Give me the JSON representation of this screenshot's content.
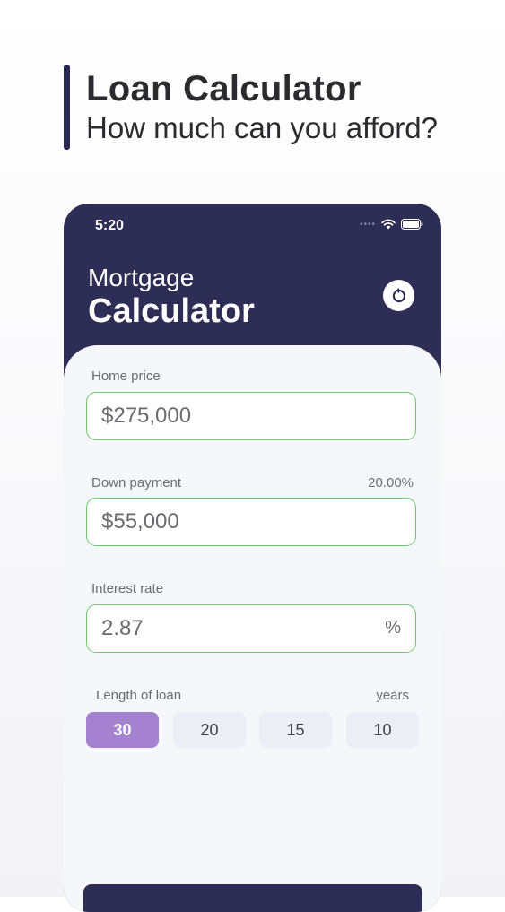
{
  "hero": {
    "title": "Loan Calculator",
    "subtitle": "How much can you afford?"
  },
  "status": {
    "time": "5:20"
  },
  "app": {
    "title_line1": "Mortgage",
    "title_line2": "Calculator"
  },
  "form": {
    "home_price": {
      "label": "Home price",
      "value": "$275,000"
    },
    "down_payment": {
      "label": "Down payment",
      "percent": "20.00%",
      "value": "$55,000"
    },
    "interest_rate": {
      "label": "Interest rate",
      "value": "2.87",
      "suffix": "%"
    },
    "loan_length": {
      "label": "Length of loan",
      "unit": "years",
      "options": [
        "30",
        "20",
        "15",
        "10"
      ],
      "selected": "30"
    }
  },
  "colors": {
    "brand_dark": "#2e2d55",
    "accent_purple": "#a582cf",
    "field_border_green": "#6fc66f"
  },
  "icons": {
    "reset": "reset-icon",
    "wifi": "wifi-icon",
    "battery": "battery-icon",
    "signal": "signal-dots-icon"
  }
}
